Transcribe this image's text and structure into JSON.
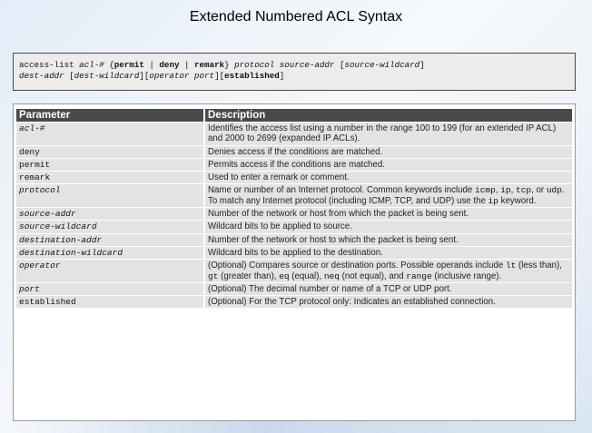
{
  "title": "Extended Numbered ACL Syntax",
  "syntax": {
    "line1": [
      {
        "t": "access-list ",
        "s": ""
      },
      {
        "t": "acl-#",
        "s": "it"
      },
      {
        "t": " {",
        "s": ""
      },
      {
        "t": "permit",
        "s": "kw"
      },
      {
        "t": " | ",
        "s": ""
      },
      {
        "t": "deny",
        "s": "kw"
      },
      {
        "t": " | ",
        "s": ""
      },
      {
        "t": "remark",
        "s": "kw"
      },
      {
        "t": "} ",
        "s": ""
      },
      {
        "t": "protocol source-addr",
        "s": "it"
      },
      {
        "t": " [",
        "s": ""
      },
      {
        "t": "source-wildcard",
        "s": "it"
      },
      {
        "t": "]",
        "s": ""
      }
    ],
    "line2": [
      {
        "t": "dest-addr",
        "s": "it"
      },
      {
        "t": " [",
        "s": ""
      },
      {
        "t": "dest-wildcard",
        "s": "it"
      },
      {
        "t": "][",
        "s": ""
      },
      {
        "t": "operator port",
        "s": "it"
      },
      {
        "t": "][",
        "s": ""
      },
      {
        "t": "established",
        "s": "kw"
      },
      {
        "t": "]",
        "s": ""
      }
    ]
  },
  "table": {
    "headers": [
      "Parameter",
      "Description"
    ],
    "rows": [
      {
        "param": "acl-#",
        "italic": true,
        "desc": [
          {
            "t": "Identifies the access list using a number in the range 100 to 199 (for an extended IP ACL) and 2000 to 2699 (expanded IP ACLs)."
          }
        ]
      },
      {
        "param": "deny",
        "italic": false,
        "desc": [
          {
            "t": "Denies access if the conditions are matched."
          }
        ]
      },
      {
        "param": "permit",
        "italic": false,
        "desc": [
          {
            "t": "Permits access if the conditions are matched."
          }
        ]
      },
      {
        "param": "remark",
        "italic": false,
        "desc": [
          {
            "t": "Used to enter a remark or comment."
          }
        ]
      },
      {
        "param": "protocol",
        "italic": true,
        "desc": [
          {
            "t": "Name or number of an Internet protocol. Common keywords include "
          },
          {
            "t": "icmp",
            "code": true
          },
          {
            "t": ", "
          },
          {
            "t": "ip",
            "code": true
          },
          {
            "t": ", "
          },
          {
            "t": "tcp",
            "code": true
          },
          {
            "t": ", or "
          },
          {
            "t": "udp",
            "code": true
          },
          {
            "t": ". To match any Internet protocol (including ICMP, TCP, and UDP) use the "
          },
          {
            "t": "ip",
            "code": true
          },
          {
            "t": " keyword."
          }
        ]
      },
      {
        "param": "source-addr",
        "italic": true,
        "desc": [
          {
            "t": "Number of the network or host from which the packet is being sent."
          }
        ]
      },
      {
        "param": "source-wildcard",
        "italic": true,
        "desc": [
          {
            "t": "Wildcard bits to be applied to source."
          }
        ]
      },
      {
        "param": "destination-addr",
        "italic": true,
        "desc": [
          {
            "t": "Number of the network or host to which the packet is being sent."
          }
        ]
      },
      {
        "param": "destination-wildcard",
        "italic": true,
        "desc": [
          {
            "t": "Wildcard bits to be applied to the destination."
          }
        ]
      },
      {
        "param": "operator",
        "italic": true,
        "desc": [
          {
            "t": "(Optional) Compares source or destination ports. Possible operands include "
          },
          {
            "t": "lt",
            "code": true
          },
          {
            "t": " (less than), "
          },
          {
            "t": "gt",
            "code": true
          },
          {
            "t": " (greater than), "
          },
          {
            "t": "eq",
            "code": true
          },
          {
            "t": " (equal), "
          },
          {
            "t": "neq",
            "code": true
          },
          {
            "t": " (not equal), and "
          },
          {
            "t": "range",
            "code": true
          },
          {
            "t": " (inclusive range)."
          }
        ]
      },
      {
        "param": "port",
        "italic": true,
        "desc": [
          {
            "t": "(Optional) The decimal number or name of a TCP or UDP port."
          }
        ]
      },
      {
        "param": "established",
        "italic": false,
        "desc": [
          {
            "t": "(Optional) For the TCP protocol only: Indicates an established connection."
          }
        ]
      }
    ]
  }
}
